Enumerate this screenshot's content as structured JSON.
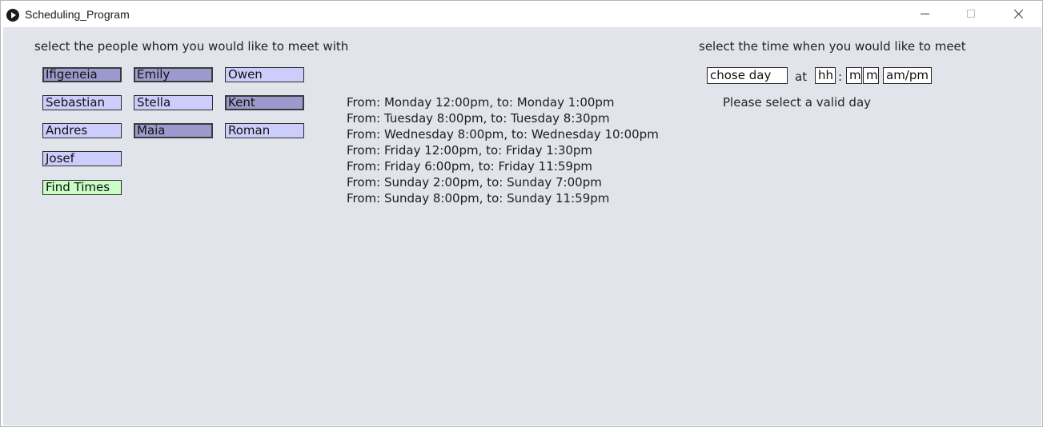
{
  "window": {
    "title": "Scheduling_Program"
  },
  "people_section": {
    "heading": "select the people whom you would like to meet with",
    "people": [
      {
        "name": "Ifigeneia",
        "selected": true
      },
      {
        "name": "Emily",
        "selected": true
      },
      {
        "name": "Owen",
        "selected": false
      },
      {
        "name": "Sebastian",
        "selected": false
      },
      {
        "name": "Stella",
        "selected": false
      },
      {
        "name": "Kent",
        "selected": true
      },
      {
        "name": "Andres",
        "selected": false
      },
      {
        "name": "Maia",
        "selected": true
      },
      {
        "name": "Roman",
        "selected": false
      },
      {
        "name": "Josef",
        "selected": false
      }
    ],
    "find_button": "Find Times"
  },
  "results": {
    "slots": [
      "From: Monday 12:00pm, to: Monday 1:00pm",
      "From: Tuesday 8:00pm, to: Tuesday 8:30pm",
      "From: Wednesday 8:00pm, to: Wednesday 10:00pm",
      "From: Friday 12:00pm, to: Friday 1:30pm",
      "From: Friday 6:00pm, to: Friday 11:59pm",
      "From: Sunday 2:00pm, to: Sunday 7:00pm",
      "From: Sunday 8:00pm, to: Sunday 11:59pm"
    ]
  },
  "time_section": {
    "heading": "select the time when you would like to meet",
    "day_field": "chose day",
    "at_label": "at",
    "hour_field": "hh",
    "colon": ":",
    "minute_field_1": "m",
    "minute_field_2": "m",
    "ampm_field": "am/pm",
    "message": "Please select a valid day"
  },
  "colors": {
    "background": "#e1e4ea",
    "person_unselected": "#cdcdfc",
    "person_selected": "#9c9acc",
    "find_button": "#c8fdc6"
  }
}
